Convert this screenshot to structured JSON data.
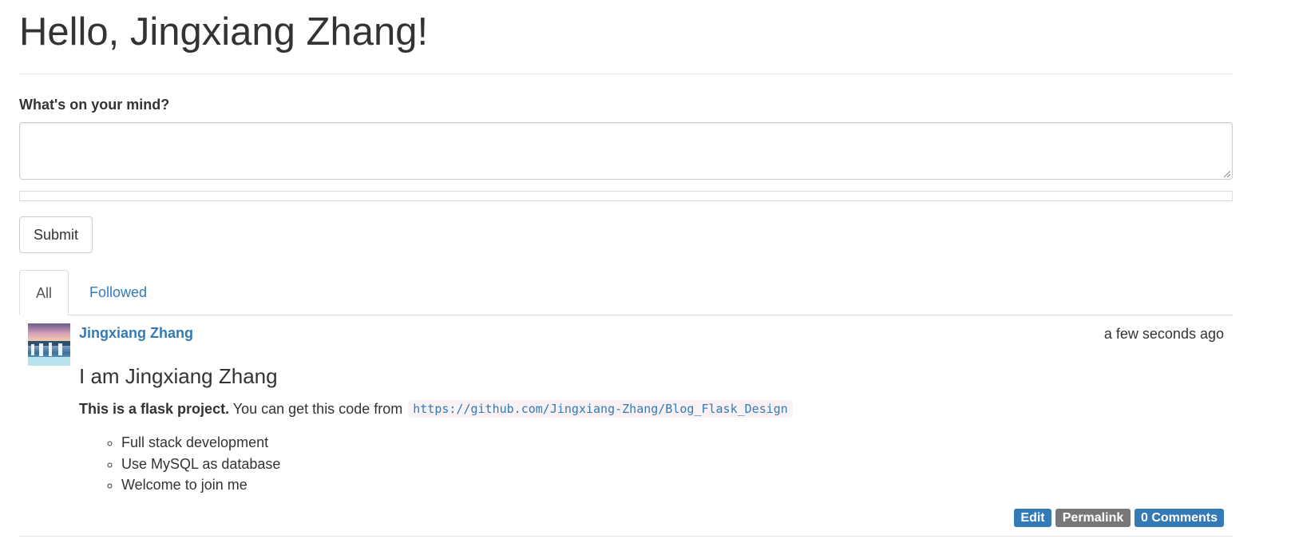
{
  "header": {
    "title": "Hello, Jingxiang Zhang!"
  },
  "post_form": {
    "label": "What's on your mind?",
    "body_value": "",
    "submit_label": "Submit"
  },
  "tabs": [
    {
      "label": "All",
      "active": true
    },
    {
      "label": "Followed",
      "active": false
    }
  ],
  "posts": [
    {
      "author": "Jingxiang Zhang",
      "timestamp": "a few seconds ago",
      "title": "I am Jingxiang Zhang",
      "intro_bold": "This is a flask project.",
      "intro_text": " You can get this code from ",
      "code_link": "https://github.com/Jingxiang-Zhang/Blog_Flask_Design",
      "bullets": [
        "Full stack development",
        "Use MySQL as database",
        "Welcome to join me"
      ],
      "actions": {
        "edit": "Edit",
        "permalink": "Permalink",
        "comments": "0 Comments"
      }
    }
  ],
  "colors": {
    "link": "#337ab7",
    "label_default": "#777777",
    "text": "#333333"
  }
}
